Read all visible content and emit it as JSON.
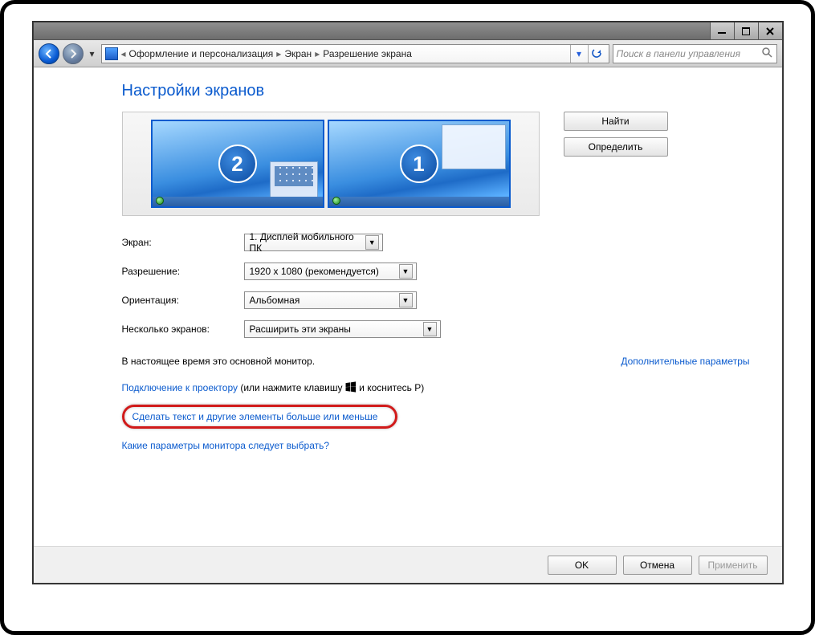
{
  "breadcrumb": {
    "p1": "Оформление и персонализация",
    "p2": "Экран",
    "p3": "Разрешение экрана"
  },
  "search_placeholder": "Поиск в панели управления",
  "page_title": "Настройки экранов",
  "side_buttons": {
    "find": "Найти",
    "identify": "Определить"
  },
  "monitors": {
    "left_num": "2",
    "right_num": "1"
  },
  "labels": {
    "screen": "Экран:",
    "resolution": "Разрешение:",
    "orientation": "Ориентация:",
    "multiple": "Несколько экранов:"
  },
  "values": {
    "screen": "1. Дисплей мобильного ПК",
    "resolution": "1920 x 1080 (рекомендуется)",
    "orientation": "Альбомная",
    "multiple": "Расширить эти экраны"
  },
  "status_primary": "В настоящее время это основной монитор.",
  "advanced_link": "Дополнительные параметры",
  "projector_link": "Подключение к проектору",
  "projector_tail_a": " (или нажмите клавишу ",
  "projector_tail_b": " и коснитесь P)",
  "text_size_link": "Сделать текст и другие элементы больше или меньше",
  "which_settings_link": "Какие параметры монитора следует выбрать?",
  "footer": {
    "ok": "OK",
    "cancel": "Отмена",
    "apply": "Применить"
  }
}
